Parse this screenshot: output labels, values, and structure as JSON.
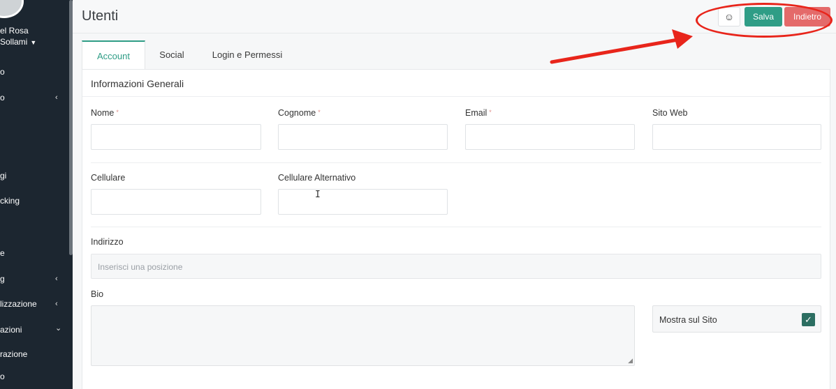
{
  "sidebar": {
    "user_name_line1": "el Rosa",
    "user_name_line2": "Sollami",
    "items": [
      {
        "label": "o",
        "chevron": ""
      },
      {
        "label": "o",
        "chevron": "‹"
      },
      {
        "label": "gi",
        "chevron": ""
      },
      {
        "label": "cking",
        "chevron": ""
      },
      {
        "label": "e",
        "chevron": ""
      },
      {
        "label": "g",
        "chevron": "‹"
      },
      {
        "label": "lizzazione",
        "chevron": "‹"
      },
      {
        "label": "azioni",
        "chevron": "⌄"
      },
      {
        "label": "razione",
        "chevron": ""
      },
      {
        "label": "o",
        "chevron": ""
      }
    ]
  },
  "header": {
    "title": "Utenti",
    "emoji_button": "☺",
    "save_label": "Salva",
    "back_label": "Indietro"
  },
  "tabs": [
    {
      "label": "Account",
      "active": true
    },
    {
      "label": "Social",
      "active": false
    },
    {
      "label": "Login e Permessi",
      "active": false
    }
  ],
  "form": {
    "section_title": "Informazioni Generali",
    "required_mark": "*",
    "fields": {
      "nome": {
        "label": "Nome",
        "value": ""
      },
      "cognome": {
        "label": "Cognome",
        "value": ""
      },
      "email": {
        "label": "Email",
        "value": ""
      },
      "sito_web": {
        "label": "Sito Web",
        "value": ""
      },
      "cellulare": {
        "label": "Cellulare",
        "value": ""
      },
      "cellulare_alt": {
        "label": "Cellulare Alternativo",
        "value": ""
      },
      "indirizzo": {
        "label": "Indirizzo",
        "placeholder": "Inserisci una posizione"
      },
      "bio": {
        "label": "Bio",
        "value": ""
      }
    },
    "show_on_site": {
      "label": "Mostra sul Sito",
      "checked": true
    }
  },
  "colors": {
    "accent": "#2f9d86",
    "danger": "#e46a6a",
    "sidebar": "#1c2630",
    "annotation": "#e8251b"
  }
}
